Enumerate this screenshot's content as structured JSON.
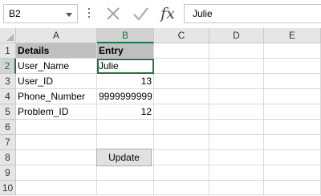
{
  "namebox": {
    "value": "B2"
  },
  "formula": {
    "value": "Julie"
  },
  "icons": {
    "cancel": "close-icon",
    "enter": "check-icon",
    "function": "fx-icon"
  },
  "columns": [
    "A",
    "B",
    "C",
    "D",
    "E"
  ],
  "rows": [
    "1",
    "2",
    "3",
    "4",
    "5",
    "6",
    "7",
    "8",
    "9",
    "10"
  ],
  "cells": {
    "A1": "Details",
    "B1": "Entry",
    "A2": "User_Name",
    "B2": "Julie",
    "A3": "User_ID",
    "B3": "13",
    "A4": "Phone_Number",
    "B4": "9999999999",
    "A5": "Problem_ID",
    "B5": "12"
  },
  "button": {
    "label": "Update"
  },
  "colors": {
    "accent": "#217346",
    "header_fill": "#bfbfbf"
  }
}
